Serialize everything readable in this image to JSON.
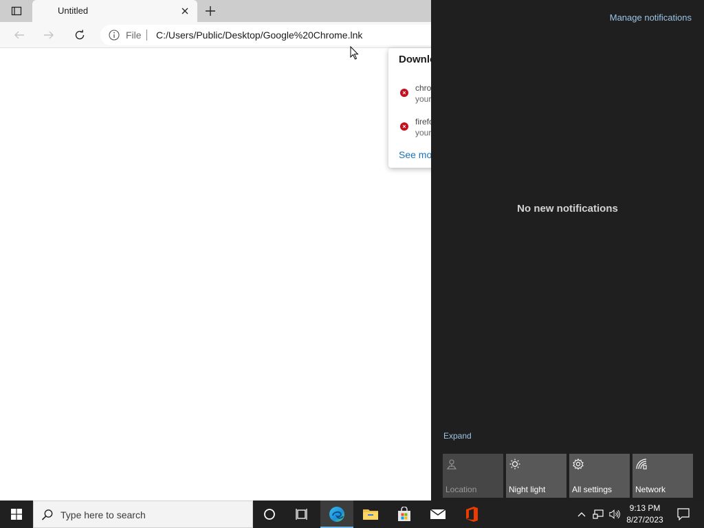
{
  "browser": {
    "tab": {
      "title": "Untitled"
    },
    "address": {
      "scheme": "File",
      "url": "C:/Users/Public/Desktop/Google%20Chrome.lnk"
    }
  },
  "downloads": {
    "title": "Downlo",
    "items": [
      {
        "name": "chro",
        "status": "your"
      },
      {
        "name": "firefo",
        "status": "your"
      }
    ],
    "see_more": "See mo"
  },
  "action_center": {
    "manage": "Manage notifications",
    "empty_message": "No new notifications",
    "expand": "Expand",
    "tiles": [
      {
        "label": "Location",
        "icon": "location-icon",
        "enabled": false
      },
      {
        "label": "Night light",
        "icon": "night-light-icon",
        "enabled": true
      },
      {
        "label": "All settings",
        "icon": "settings-gear-icon",
        "enabled": true
      },
      {
        "label": "Network",
        "icon": "network-icon",
        "enabled": true
      }
    ]
  },
  "taskbar": {
    "search_placeholder": "Type here to search",
    "clock": {
      "time": "9:13 PM",
      "date": "8/27/2023"
    }
  },
  "colors": {
    "accent": "#76b9ed",
    "action_center_bg": "#1f1f1f",
    "taskbar_bg": "#202020",
    "error_red": "#c50f1f",
    "link_blue": "#9cc4e6"
  }
}
